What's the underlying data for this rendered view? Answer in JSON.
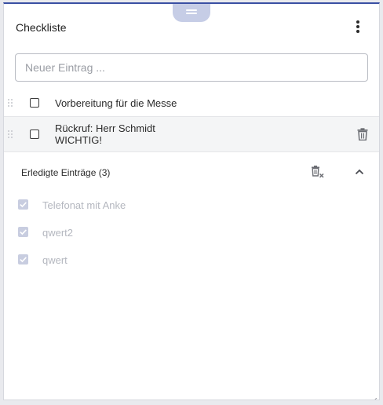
{
  "header": {
    "title": "Checkliste",
    "more_icon": "more-vertical-icon"
  },
  "input": {
    "placeholder": "Neuer Eintrag ...",
    "value": ""
  },
  "open_items": [
    {
      "line1": "Vorbereitung für die Messe",
      "line2": "",
      "checked": false
    },
    {
      "line1": "Rückruf: Herr Schmidt",
      "line2": "WICHTIG!",
      "checked": false
    }
  ],
  "done_section": {
    "title": "Erledigte Einträge (3)",
    "clear_icon": "delete-sweep-icon",
    "collapse_icon": "chevron-up-icon",
    "items": [
      {
        "label": "Telefonat mit Anke",
        "checked": true
      },
      {
        "label": "qwert2",
        "checked": true
      },
      {
        "label": "qwert",
        "checked": true
      }
    ]
  },
  "colors": {
    "accent": "#3a4fa3",
    "drag_tab": "#c6cde6",
    "done_checkbox": "#c8cde0",
    "done_text": "#b4b7bf"
  }
}
